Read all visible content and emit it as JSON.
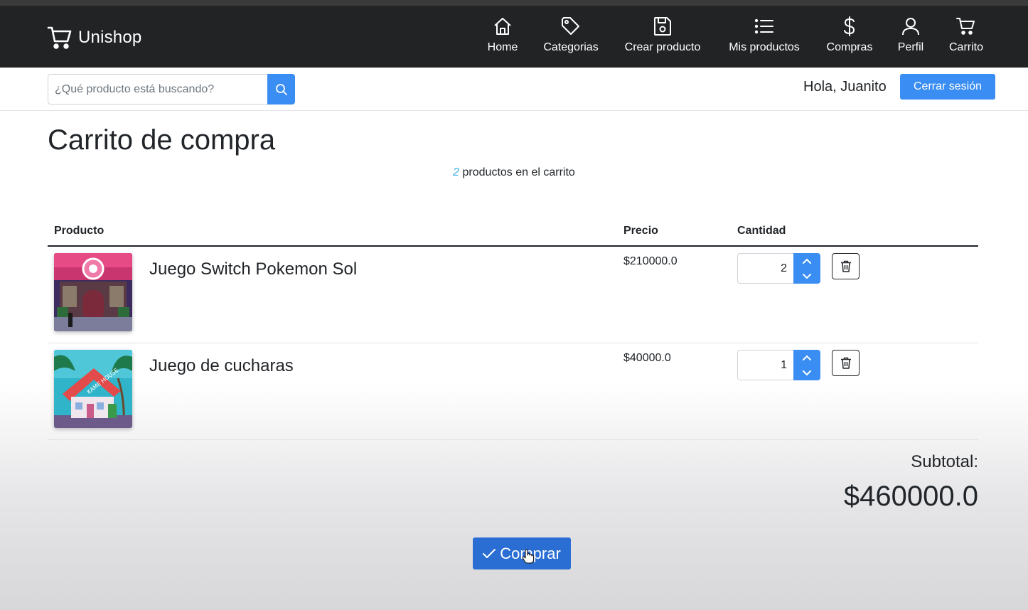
{
  "brand": {
    "name": "Unishop",
    "icon": "cart-icon"
  },
  "nav": [
    {
      "label": "Home",
      "icon": "home-icon"
    },
    {
      "label": "Categorias",
      "icon": "tag-icon"
    },
    {
      "label": "Crear producto",
      "icon": "save-icon"
    },
    {
      "label": "Mis productos",
      "icon": "list-icon"
    },
    {
      "label": "Compras",
      "icon": "dollar-icon"
    },
    {
      "label": "Perfil",
      "icon": "user-icon"
    },
    {
      "label": "Carrito",
      "icon": "cart-icon"
    }
  ],
  "search": {
    "placeholder": "¿Qué producto está buscando?",
    "value": "",
    "icon": "search-icon"
  },
  "user": {
    "greeting": "Hola, Juanito",
    "logout_label": "Cerrar sesión"
  },
  "cart": {
    "title": "Carrito de compra",
    "count": "2",
    "count_suffix": " productos en el carrito",
    "headers": {
      "product": "Producto",
      "price": "Precio",
      "quantity": "Cantidad"
    },
    "items": [
      {
        "name": "Juego Switch Pokemon Sol",
        "price": "$210000.0",
        "quantity": "2"
      },
      {
        "name": "Juego de cucharas",
        "price": "$40000.0",
        "quantity": "1"
      }
    ],
    "subtotal_label": "Subtotal:",
    "subtotal_value": "$460000.0",
    "buy_label": "Comprar"
  },
  "colors": {
    "navbar": "#222324",
    "primary": "#3a8df2",
    "buy": "#2a6ed4",
    "accent_count": "#3ab0e0"
  }
}
